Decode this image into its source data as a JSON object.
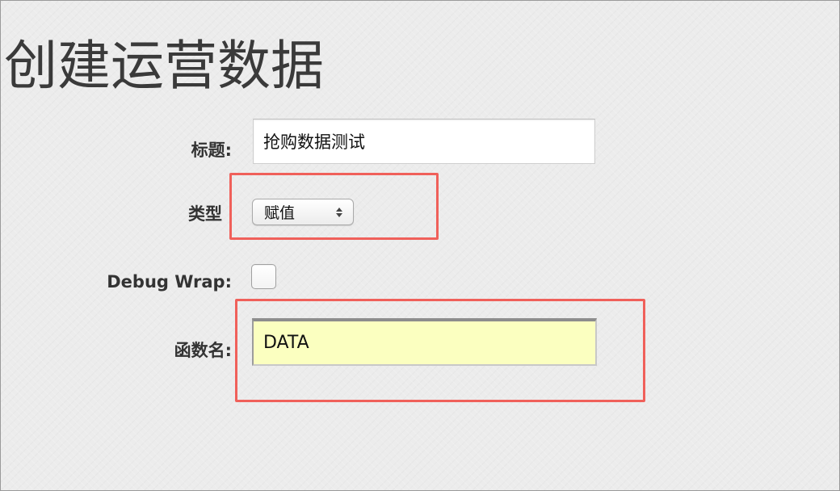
{
  "page": {
    "title": "创建运营数据"
  },
  "form": {
    "title_label": "标题:",
    "title_value": "抢购数据测试",
    "type_label": "类型",
    "type_selected": "赋值",
    "debug_wrap_label": "Debug Wrap:",
    "debug_wrap_checked": false,
    "function_name_label": "函数名:",
    "function_name_value": "DATA"
  },
  "colors": {
    "highlight": "#f0605a",
    "function_input_bg": "#fbffc0"
  }
}
